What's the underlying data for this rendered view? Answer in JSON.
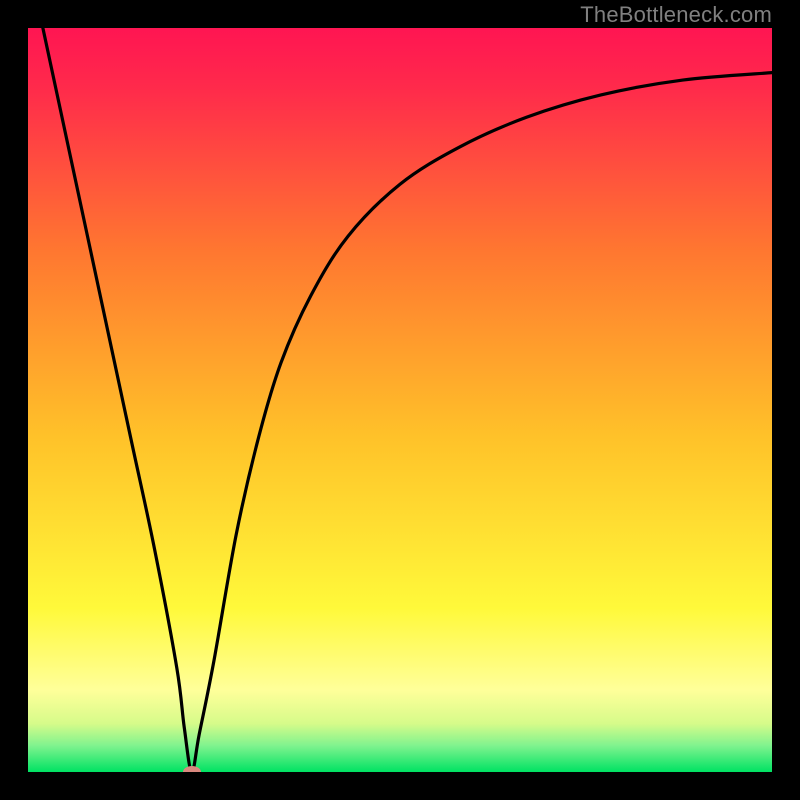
{
  "watermark": "TheBottleneck.com",
  "colors": {
    "red_top": "#ff1552",
    "orange": "#ff8e27",
    "yellow": "#fffb3a",
    "pale_yellow": "#ffff9a",
    "pale_green": "#9cf89c",
    "green_bottom": "#00e263",
    "frame_black": "#000000",
    "curve": "#000000",
    "marker": "#d9887e"
  },
  "chart_data": {
    "type": "line",
    "title": "",
    "xlabel": "",
    "ylabel": "",
    "xlim": [
      0,
      100
    ],
    "ylim": [
      0,
      100
    ],
    "grid": false,
    "legend": false,
    "series": [
      {
        "name": "bottleneck-curve",
        "x": [
          2,
          5,
          8,
          11,
          14,
          17,
          20,
          21,
          22,
          23,
          25,
          28,
          31,
          34,
          38,
          43,
          50,
          58,
          67,
          77,
          88,
          100
        ],
        "values": [
          100,
          86,
          72,
          58,
          44,
          30,
          14,
          6,
          0,
          5,
          15,
          32,
          45,
          55,
          64,
          72,
          79,
          84,
          88,
          91,
          93,
          94
        ]
      }
    ],
    "marker": {
      "x": 22,
      "y": 0
    },
    "gradient_stops": [
      {
        "pos": 0.0,
        "color": "#ff1552"
      },
      {
        "pos": 0.08,
        "color": "#ff2a4b"
      },
      {
        "pos": 0.3,
        "color": "#ff7730"
      },
      {
        "pos": 0.55,
        "color": "#ffc229"
      },
      {
        "pos": 0.78,
        "color": "#fff93a"
      },
      {
        "pos": 0.89,
        "color": "#ffff9a"
      },
      {
        "pos": 0.935,
        "color": "#d6fb8a"
      },
      {
        "pos": 0.965,
        "color": "#7ef38e"
      },
      {
        "pos": 1.0,
        "color": "#00e263"
      }
    ]
  }
}
